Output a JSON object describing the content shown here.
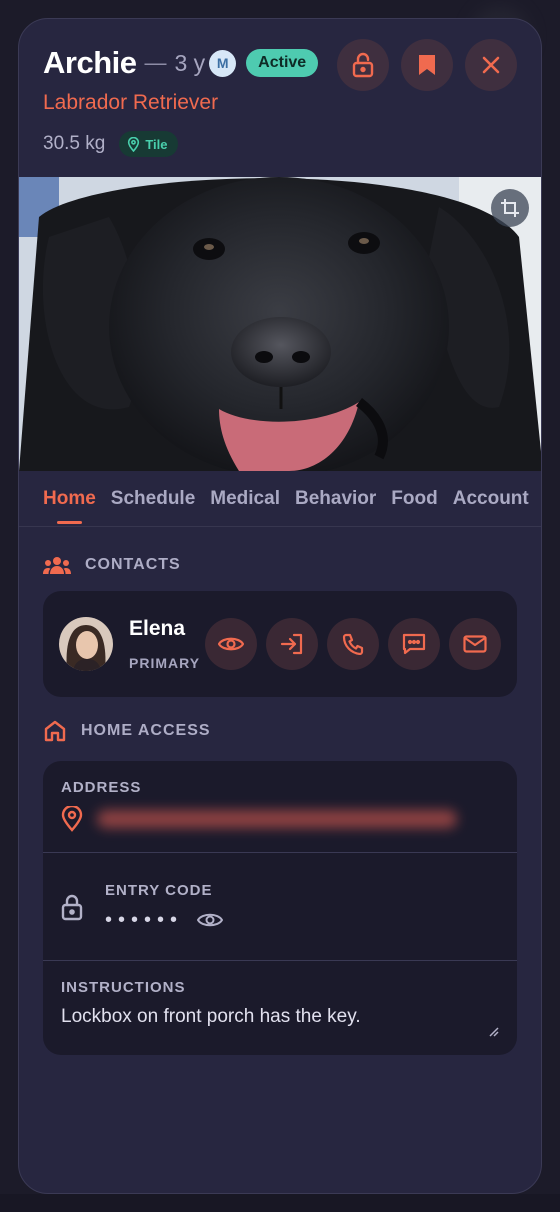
{
  "pet": {
    "name": "Archie",
    "age": "3 y",
    "sex_badge": "M",
    "status": "Active",
    "breed": "Labrador Retriever",
    "weight": "30.5 kg",
    "location_badge": "Tile"
  },
  "header_actions": [
    {
      "icon": "lock-open-icon"
    },
    {
      "icon": "bookmark-icon"
    },
    {
      "icon": "close-icon"
    }
  ],
  "photo": {
    "subject": "black labrador retriever",
    "crop_icon": "crop-icon"
  },
  "tabs": [
    {
      "label": "Home",
      "active": true
    },
    {
      "label": "Schedule"
    },
    {
      "label": "Medical"
    },
    {
      "label": "Behavior"
    },
    {
      "label": "Food"
    },
    {
      "label": "Account"
    }
  ],
  "contacts": {
    "title": "CONTACTS",
    "primary": {
      "name": "Elena",
      "role": "PRIMARY"
    },
    "actions": [
      "view-icon",
      "login-icon",
      "phone-icon",
      "message-icon",
      "mail-icon"
    ]
  },
  "home_access": {
    "title": "HOME ACCESS",
    "address_label": "ADDRESS",
    "entry_code_label": "ENTRY CODE",
    "entry_code_masked": "••••••",
    "instructions_label": "INSTRUCTIONS",
    "instructions": "Lockbox on front porch has the key."
  },
  "colors": {
    "accent": "#f06a4f",
    "status": "#4ecbb0",
    "card_bg": "#272640",
    "panel_bg": "#1b1a2b"
  }
}
